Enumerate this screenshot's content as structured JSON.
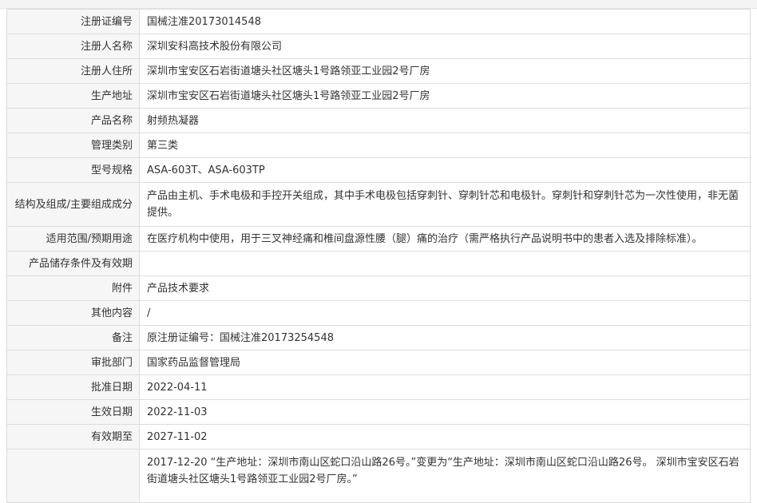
{
  "rows": [
    {
      "label": "注册证编号",
      "value": "国械注准20173014548"
    },
    {
      "label": "注册人名称",
      "value": "深圳安科高技术股份有限公司"
    },
    {
      "label": "注册人住所",
      "value": "深圳市宝安区石岩街道塘头社区塘头1号路领亚工业园2号厂房"
    },
    {
      "label": "生产地址",
      "value": "深圳市宝安区石岩街道塘头社区塘头1号路领亚工业园2号厂房"
    },
    {
      "label": "产品名称",
      "value": "射频热凝器"
    },
    {
      "label": "管理类别",
      "value": "第三类"
    },
    {
      "label": "型号规格",
      "value": "ASA-603T、ASA-603TP"
    },
    {
      "label": "结构及组成/主要组成成分",
      "value": "产品由主机、手术电极和手控开关组成，其中手术电极包括穿刺针、穿刺针芯和电极针。穿刺针和穿刺针芯为一次性使用，非无菌提供。"
    },
    {
      "label": "适用范围/预期用途",
      "value": "在医疗机构中使用，用于三叉神经痛和椎间盘源性腰（腿）痛的治疗（需严格执行产品说明书中的患者入选及排除标准）。"
    },
    {
      "label": "产品储存条件及有效期",
      "value": ""
    },
    {
      "label": "附件",
      "value": "产品技术要求"
    },
    {
      "label": "其他内容",
      "value": "/"
    },
    {
      "label": "备注",
      "value": "原注册证编号：国械注准20173254548"
    },
    {
      "label": "审批部门",
      "value": "国家药品监督管理局"
    },
    {
      "label": "批准日期",
      "value": "2022-04-11"
    },
    {
      "label": "生效日期",
      "value": "2022-11-03"
    },
    {
      "label": "有效期至",
      "value": "2027-11-02"
    },
    {
      "label": "",
      "value": "2017-12-20 “生产地址：深圳市南山区蛇口沿山路26号。”变更为“生产地址：深圳市南山区蛇口沿山路26号。 深圳市宝安区石岩街道塘头社区塘头1号路领亚工业园2号厂房。”"
    }
  ]
}
